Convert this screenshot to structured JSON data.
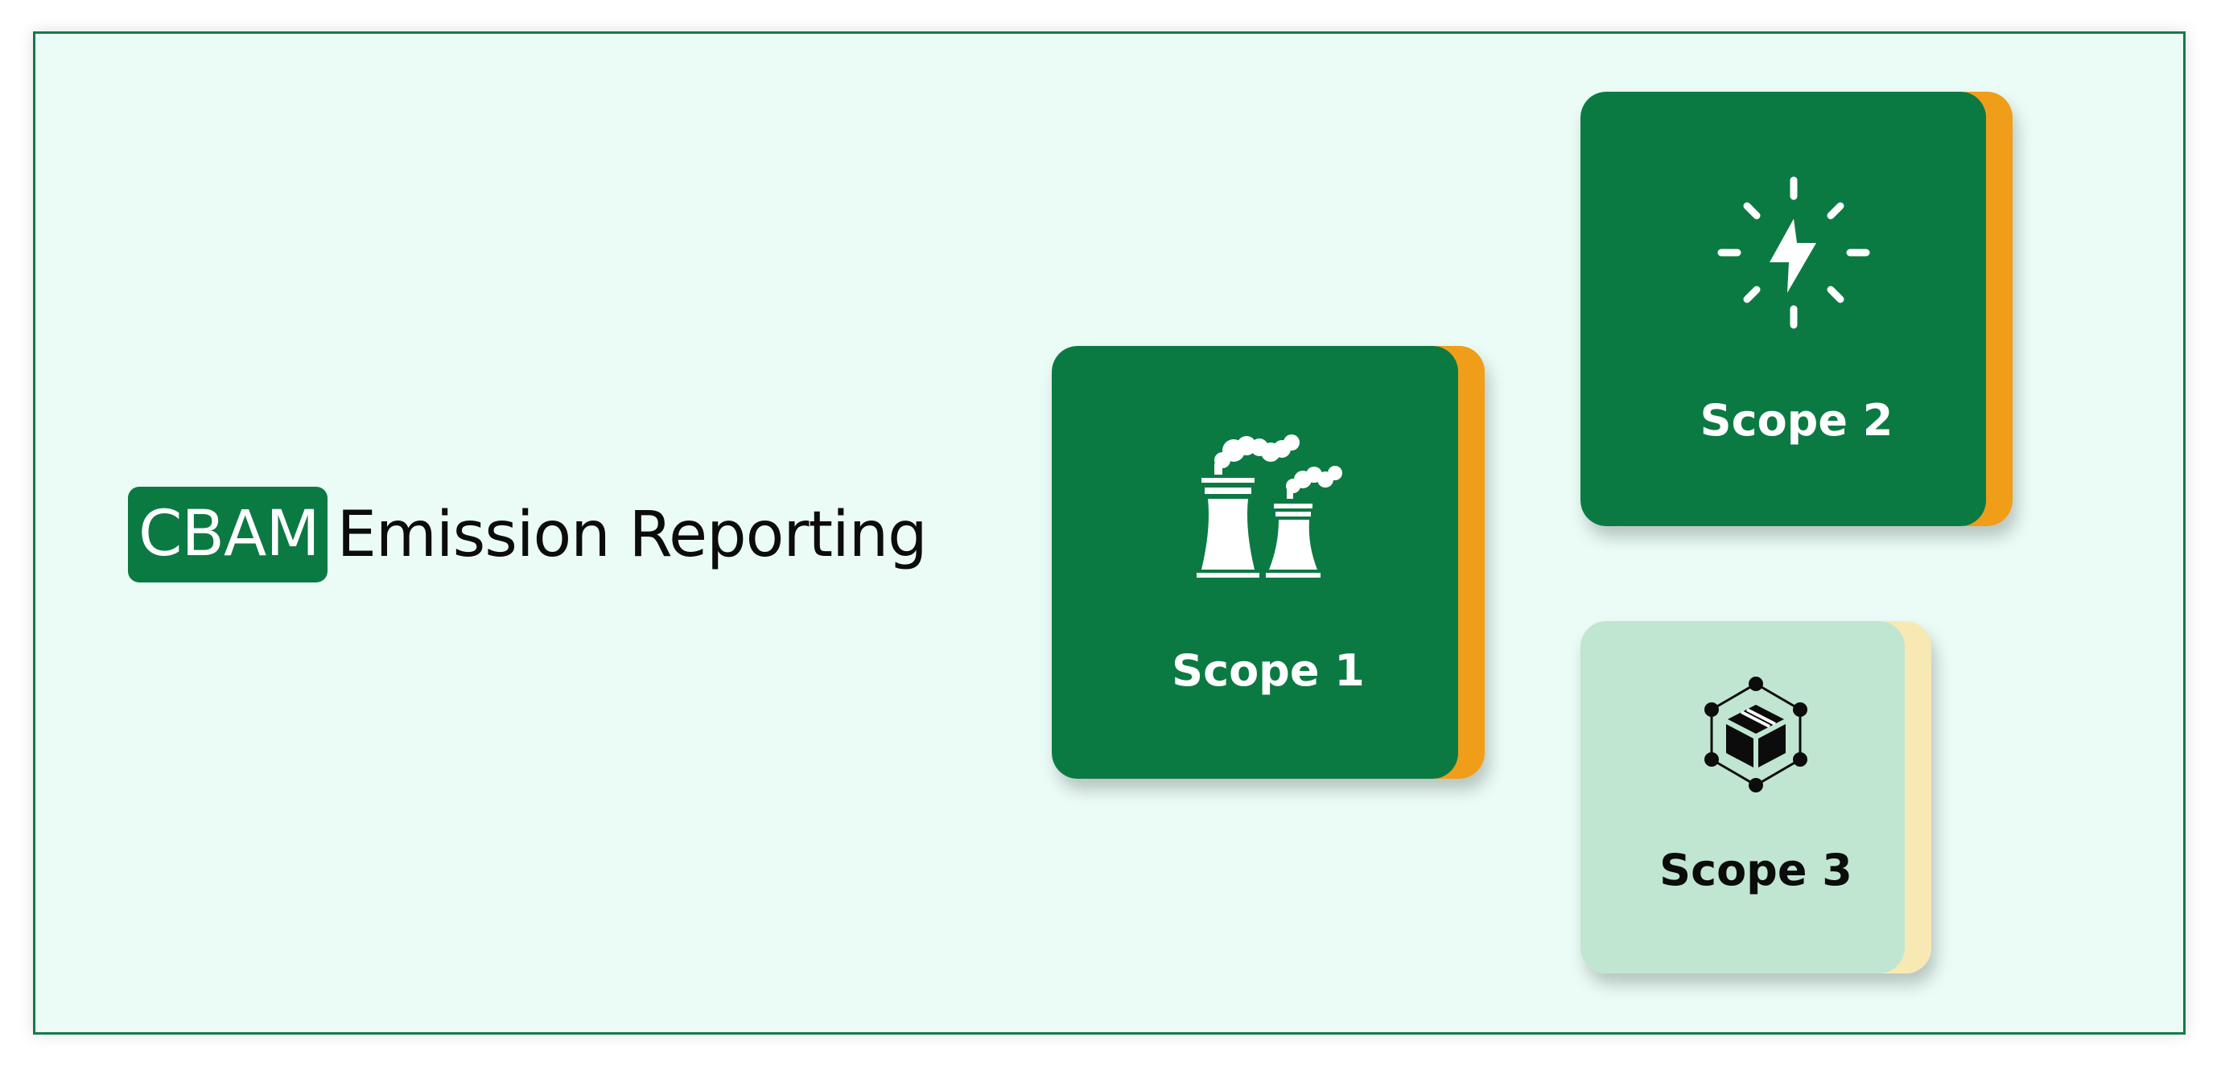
{
  "colors": {
    "background": "#ebfcf7",
    "frame_border": "#157a49",
    "brand_green": "#0b7a42",
    "accent_orange": "#f09d1a",
    "light_card": "#c0e6d1",
    "light_accent": "#f8e9b4"
  },
  "headline": {
    "badge": "CBAM",
    "rest": "Emission Reporting"
  },
  "cards": [
    {
      "label": "Scope 1",
      "icon": "factory-smoke-icon"
    },
    {
      "label": "Scope 2",
      "icon": "energy-bolt-icon"
    },
    {
      "label": "Scope 3",
      "icon": "supply-chain-box-icon"
    }
  ]
}
